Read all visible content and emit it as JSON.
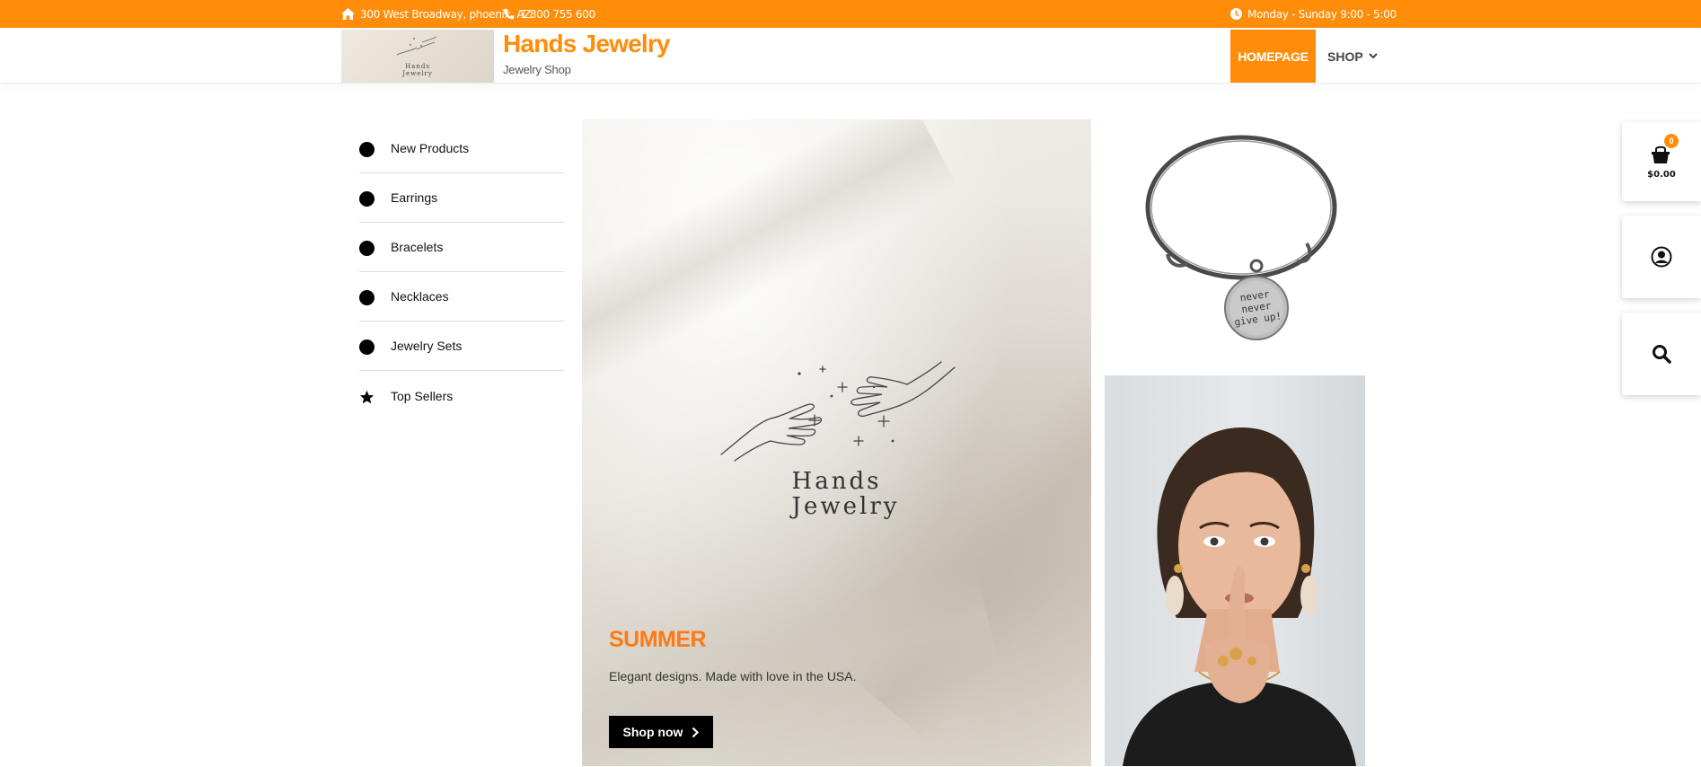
{
  "topbar": {
    "address": "300 West Broadway, phoenix, AZ",
    "phone": "1 800 755 600",
    "hours": "Monday - Sunday 9:00 - 5:00",
    "icons": [
      "home-icon",
      "phone-icon",
      "clock-icon"
    ]
  },
  "header": {
    "brand_title": "Hands Jewelry",
    "brand_subtitle": "Jewelry Shop",
    "nav": {
      "home": "HOMEPAGE",
      "shop": "SHOP"
    }
  },
  "categories": [
    {
      "label": "New Products",
      "icon": "dot"
    },
    {
      "label": "Earrings",
      "icon": "dot"
    },
    {
      "label": "Bracelets",
      "icon": "dot"
    },
    {
      "label": "Necklaces",
      "icon": "dot"
    },
    {
      "label": "Jewelry Sets",
      "icon": "dot"
    },
    {
      "label": "Top Sellers",
      "icon": "star"
    }
  ],
  "hero": {
    "logo_text_1": "Hands",
    "logo_text_2": "Jewelry",
    "title": "SUMMER",
    "text": "Elegant designs. Made with love in the USA.",
    "button": "Shop now"
  },
  "bracelet": {
    "charm_line_1": "never",
    "charm_line_2": "never",
    "charm_line_3": "give up!"
  },
  "side_tools": {
    "cart_count": "0",
    "cart_total": "$0.00"
  },
  "colors": {
    "accent": "#ff8d0a",
    "hero_title": "#ff7a12",
    "button": "#000000"
  }
}
